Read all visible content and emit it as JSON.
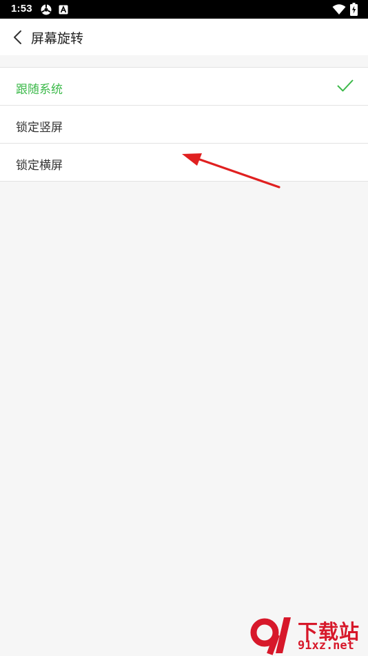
{
  "status_bar": {
    "time": "1:53",
    "left_icons": [
      "vpn-key-icon",
      "accessibility-a-icon"
    ],
    "right_icons": [
      "wifi-icon",
      "battery-charging-icon"
    ]
  },
  "header": {
    "back_icon": "chevron-left-icon",
    "title": "屏幕旋转"
  },
  "options": [
    {
      "label": "跟随系统",
      "selected": true
    },
    {
      "label": "锁定竖屏",
      "selected": false
    },
    {
      "label": "锁定横屏",
      "selected": false
    }
  ],
  "annotation": {
    "type": "arrow",
    "color": "#e02020"
  },
  "watermark": {
    "name": "下载站",
    "domain": "91xz.net",
    "color": "#d7182a"
  },
  "colors": {
    "accent": "#3cb94a",
    "background": "#f6f6f6",
    "header_bg": "#ffffff",
    "status_bar_bg": "#000000"
  }
}
